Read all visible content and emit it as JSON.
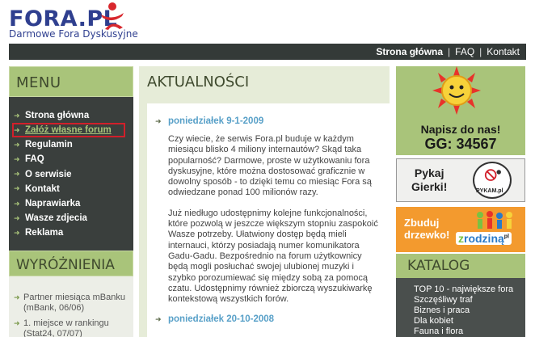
{
  "header": {
    "logo_title": "FORA.PL",
    "logo_subtitle": "Darmowe Fora Dyskusyjne"
  },
  "topnav": {
    "items": [
      {
        "label": "Strona główna",
        "active": true
      },
      {
        "label": "FAQ",
        "active": false
      },
      {
        "label": "Kontakt",
        "active": false
      }
    ],
    "separator": "|"
  },
  "menu": {
    "title": "MENU",
    "items": [
      {
        "label": "Strona główna"
      },
      {
        "label": "Załóż własne forum",
        "highlighted": true
      },
      {
        "label": "Regulamin"
      },
      {
        "label": "FAQ"
      },
      {
        "label": "O serwisie"
      },
      {
        "label": "Kontakt"
      },
      {
        "label": "Naprawiarka"
      },
      {
        "label": "Wasze zdjecia"
      },
      {
        "label": "Reklama"
      }
    ]
  },
  "wyroznienia": {
    "title": "WYRÓŻNIENIA",
    "items": [
      {
        "line1": "Partner miesiąca mBanku",
        "line2": "(mBank, 06/06)"
      },
      {
        "line1": "1. miejsce w rankingu",
        "line2": "(Stat24, 07/07)"
      }
    ]
  },
  "news": {
    "title": "AKTUALNOŚCI",
    "entries": [
      {
        "date": "poniedziałek 9-1-2009",
        "paragraphs": [
          "Czy wiecie, że serwis Fora.pl buduje w każdym miesiącu blisko 4 miliony internautów? Skąd taka popularność? Darmowe, proste w użytkowaniu fora dyskusyjne, które można dostosować graficznie w dowolny sposób - to dzięki temu co miesiąc Fora są odwiedzane ponad 100 milionów razy.",
          "Już niedługo udostępnimy kolejne funkcjonalności, które pozwolą w jeszcze większym stopniu zaspokoić Wasze potrzeby. Ułatwiony dostęp będą mieli internauci, którzy posiadają numer komunikatora Gadu-Gadu. Bezpośrednio na forum użytkownicy będą mogli posłuchać swojej ulubionej muzyki i szybko porozumiewać się między sobą za pomocą czatu. Udostępnimy również zbiorczą wyszukiwarkę kontekstową wszystkich forów."
        ]
      },
      {
        "date": "poniedziałek 20-10-2008",
        "paragraphs": []
      }
    ]
  },
  "ads": {
    "gg_line1": "Napisz do nas!",
    "gg_line2": "GG: 34567",
    "pykaj_line1": "Pykaj",
    "pykaj_line2": "Gierki!",
    "pykam_logo": "PYKAM.pl",
    "rodzina_line1": "Zbuduj",
    "rodzina_line2": "drzewko!",
    "rodzina_logo_z": "z",
    "rodzina_logo_rest": "rodziną",
    "rodzina_logo_pl": "pl"
  },
  "katalog": {
    "title": "KATALOG",
    "items": [
      "TOP 10 - największe fora",
      "Szczęśliwy traf",
      "Biznes i praca",
      "Dla kobiet",
      "Fauna i flora"
    ]
  },
  "colors": {
    "accent_green": "#a9c47a",
    "dark_panel": "#3a3f3d",
    "link_blue": "#58a0c8",
    "highlight_red": "#d21f2a",
    "orange_ad": "#f39a2e"
  }
}
